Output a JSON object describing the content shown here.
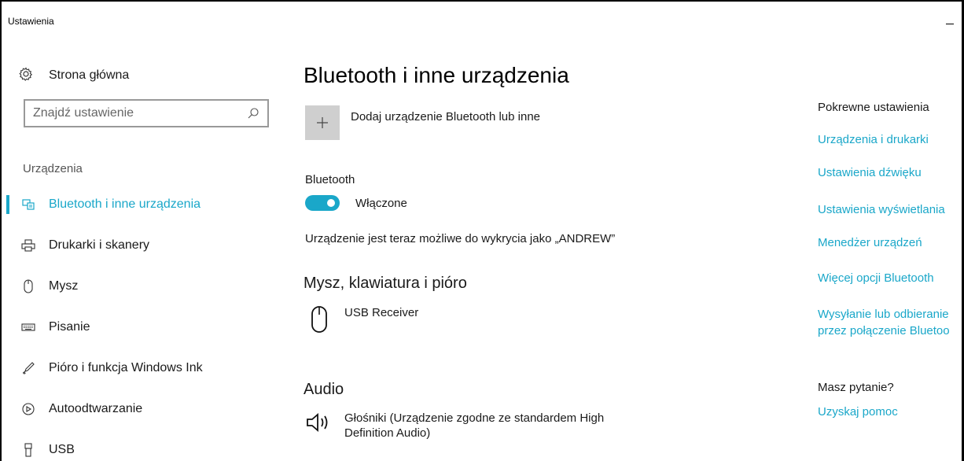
{
  "window": {
    "title": "Ustawienia"
  },
  "sidebar": {
    "home_label": "Strona główna",
    "search_placeholder": "Znajdź ustawienie",
    "section_header": "Urządzenia",
    "items": [
      {
        "label": "Bluetooth i inne urządzenia",
        "icon": "bluetooth-devices-icon",
        "active": true
      },
      {
        "label": "Drukarki i skanery",
        "icon": "printer-icon",
        "active": false
      },
      {
        "label": "Mysz",
        "icon": "mouse-icon",
        "active": false
      },
      {
        "label": "Pisanie",
        "icon": "keyboard-icon",
        "active": false
      },
      {
        "label": "Pióro i funkcja Windows Ink",
        "icon": "pen-icon",
        "active": false
      },
      {
        "label": "Autoodtwarzanie",
        "icon": "autoplay-icon",
        "active": false
      },
      {
        "label": "USB",
        "icon": "usb-icon",
        "active": false
      }
    ]
  },
  "main": {
    "title": "Bluetooth i inne urządzenia",
    "add_device_label": "Dodaj urządzenie Bluetooth lub inne",
    "bluetooth_label": "Bluetooth",
    "bluetooth_toggle_state": "Włączone",
    "discoverable_text": "Urządzenie jest teraz możliwe do wykrycia jako „ANDREW”",
    "mouse_section_title": "Mysz, klawiatura i pióro",
    "mouse_device_name": "USB Receiver",
    "audio_section_title": "Audio",
    "audio_device_name_line1": "Głośniki (Urządzenie zgodne ze standardem High",
    "audio_device_name_line2": "Definition Audio)"
  },
  "related": {
    "header": "Pokrewne ustawienia",
    "links": [
      "Urządzenia i drukarki",
      "Ustawienia dźwięku",
      "Ustawienia wyświetlania",
      "Menedżer urządzeń",
      "Więcej opcji Bluetooth"
    ],
    "send_receive_line1": "Wysyłanie lub odbieranie",
    "send_receive_line2": "przez połączenie Bluetoo",
    "question_header": "Masz pytanie?",
    "help_link": "Uzyskaj pomoc"
  },
  "colors": {
    "accent": "#1aa7c9",
    "tile": "#cfcfcf"
  }
}
